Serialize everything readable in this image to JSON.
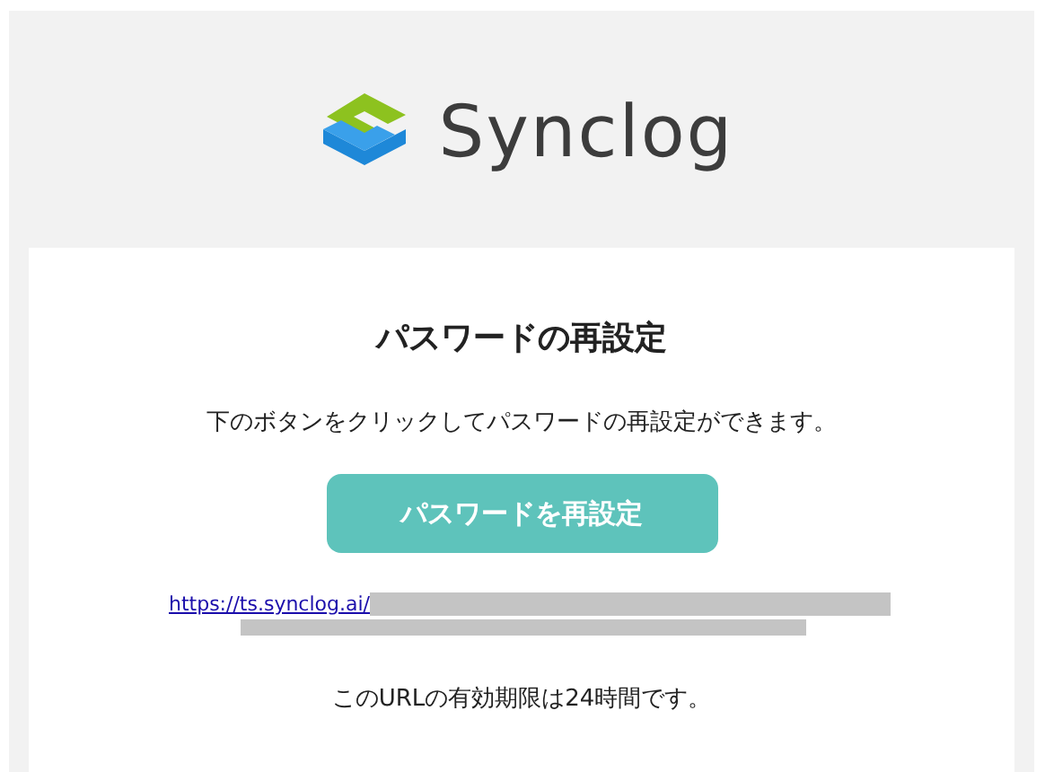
{
  "logo": {
    "name": "Synclog"
  },
  "title": "パスワードの再設定",
  "message": "下のボタンをクリックしてパスワードの再設定ができます。",
  "button": "パスワードを再設定",
  "link": {
    "text": "https://ts.synclog.ai/",
    "redacted": true
  },
  "expiry_note": "このURLの有効期限は24時間です。"
}
